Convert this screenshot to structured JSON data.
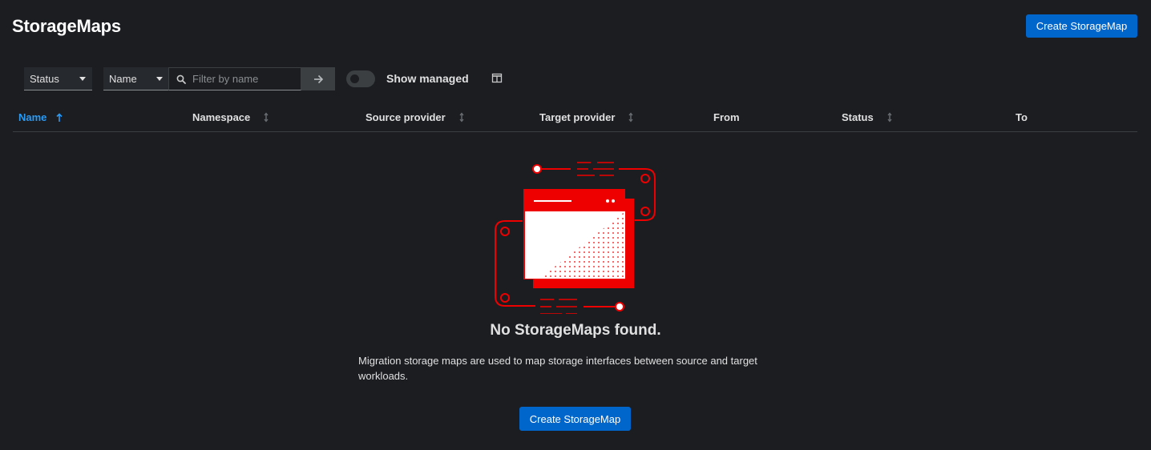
{
  "page": {
    "title": "StorageMaps",
    "create_button": "Create StorageMap"
  },
  "toolbar": {
    "status_filter": "Status",
    "name_filter": "Name",
    "search_placeholder": "Filter by name",
    "show_managed_label": "Show managed",
    "show_managed_on": false
  },
  "table": {
    "columns": [
      {
        "label": "Name",
        "sortable": true,
        "sorted": "asc"
      },
      {
        "label": "Namespace",
        "sortable": true
      },
      {
        "label": "Source provider",
        "sortable": true
      },
      {
        "label": "Target provider",
        "sortable": true
      },
      {
        "label": "From",
        "sortable": false
      },
      {
        "label": "Status",
        "sortable": true
      },
      {
        "label": "To",
        "sortable": false
      }
    ]
  },
  "empty_state": {
    "title": "No StorageMaps found.",
    "body": "Migration storage maps are used to map storage interfaces between source and target workloads.",
    "button": "Create StorageMap"
  },
  "colors": {
    "accent": "#0066cc",
    "active_sort": "#2b9af3",
    "illustration": "#ee0000",
    "background": "#1b1d21"
  }
}
